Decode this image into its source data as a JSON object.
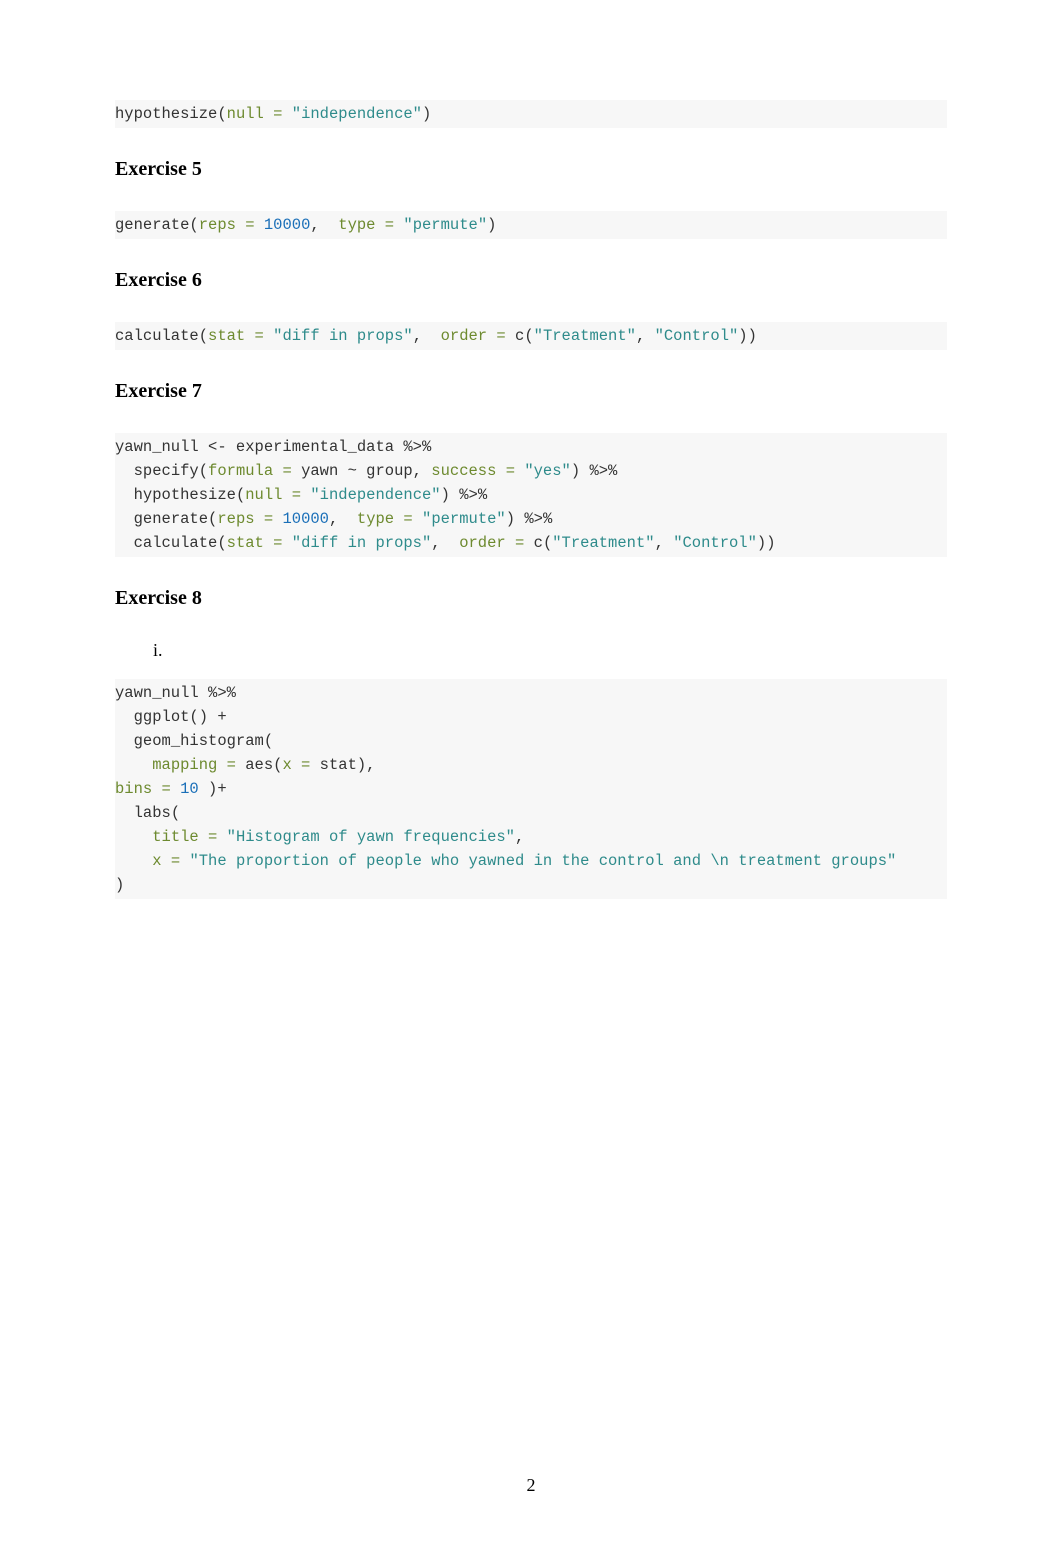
{
  "headings": {
    "ex5": "Exercise 5",
    "ex6": "Exercise 6",
    "ex7": "Exercise 7",
    "ex8": "Exercise 8"
  },
  "roman_i": "i.",
  "page_number": "2",
  "code": {
    "block1": {
      "fn_hypothesize": "hypothesize",
      "open": "(",
      "arg_null": "null = ",
      "str_independence": "\"independence\"",
      "close": ")"
    },
    "block2": {
      "fn_generate": "generate",
      "open": "(",
      "arg_reps": "reps = ",
      "num_10000": "10000",
      "comma": ",  ",
      "arg_type": "type = ",
      "str_permute": "\"permute\"",
      "close": ")"
    },
    "block3": {
      "fn_calculate": "calculate",
      "open": "(",
      "arg_stat": "stat = ",
      "str_diff": "\"diff in props\"",
      "comma": ",  ",
      "arg_order": "order = ",
      "fn_c": "c",
      "open2": "(",
      "str_treatment": "\"Treatment\"",
      "comma2": ", ",
      "str_control": "\"Control\"",
      "close2": "))"
    },
    "block4": {
      "line1_a": "yawn_null ",
      "line1_assign": "<-",
      "line1_b": " experimental_data ",
      "pipe": "%>%",
      "line2_indent": "  ",
      "fn_specify": "specify",
      "open": "(",
      "arg_formula": "formula = ",
      "formula_body": "yawn ~ group, ",
      "arg_success": "success = ",
      "str_yes": "\"yes\"",
      "close": ") ",
      "line3_indent": "  ",
      "fn_hypothesize": "hypothesize",
      "arg_null": "null = ",
      "str_independence": "\"independence\"",
      "line4_indent": "  ",
      "fn_generate": "generate",
      "arg_reps": "reps = ",
      "num_10000": "10000",
      "comma_g": ",  ",
      "arg_type": "type = ",
      "str_permute": "\"permute\"",
      "line5_indent": "  ",
      "fn_calculate": "calculate",
      "arg_stat": "stat = ",
      "str_diff": "\"diff in props\"",
      "comma_c": ",  ",
      "arg_order": "order = ",
      "fn_c": "c",
      "str_treatment": "\"Treatment\"",
      "comma2": ", ",
      "str_control": "\"Control\"",
      "close2": "))"
    },
    "block5": {
      "line1": "yawn_null ",
      "pipe": "%>%",
      "line2_indent": "  ",
      "fn_ggplot": "ggplot",
      "parens": "() ",
      "plus": "+",
      "line3_indent": "  ",
      "fn_geom": "geom_histogram",
      "open": "(",
      "line4_indent": "    ",
      "arg_mapping": "mapping = ",
      "fn_aes": "aes",
      "open_aes": "(",
      "arg_x": "x = ",
      "var_stat": "stat),",
      "line5_a": "",
      "arg_bins": "bins = ",
      "num_10": "10",
      "close_geom": " )",
      "line6_indent": "  ",
      "fn_labs": "labs",
      "line7_indent": "    ",
      "arg_title": "title = ",
      "str_title": "\"Histogram of yawn frequencies\"",
      "comma_t": ",",
      "line8_indent": "    ",
      "arg_x2": "x = ",
      "str_x": "\"The proportion of people who yawned in the control and \\n treatment groups\"",
      "line9": ")"
    }
  }
}
